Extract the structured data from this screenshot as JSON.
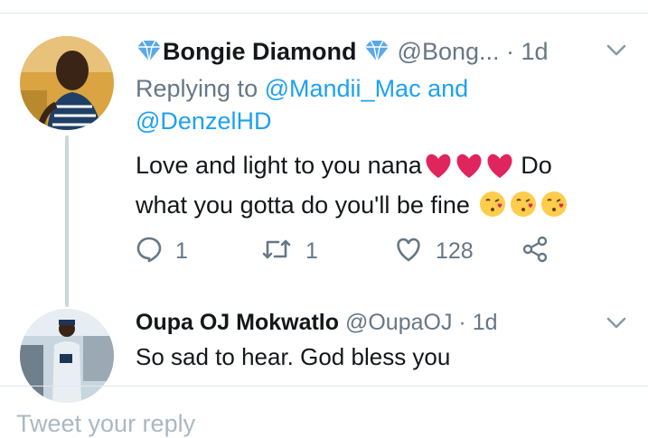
{
  "tweets": [
    {
      "author_name": "Bongie Diamond",
      "handle": "@Bong...",
      "time": "1d",
      "replying_label": "Replying to",
      "mentions": [
        "@Mandii_Mac",
        "@DenzelHD"
      ],
      "connector": "and",
      "text_part1": "Love and light to you nana",
      "text_part2": "Do",
      "text_line2": "what you gotta do you'll be fine",
      "replies_count": "1",
      "retweets_count": "1",
      "likes_count": "128",
      "icons": {
        "reply": "reply-icon",
        "retweet": "retweet-icon",
        "like": "heart-icon",
        "share": "share-icon",
        "menu": "chevron-down-icon",
        "badge": "blue-diamond-emoji"
      }
    },
    {
      "author_name": "Oupa OJ Mokwatlo",
      "handle": "@OupaOJ",
      "time": "1d",
      "text": "So sad to hear. God bless you"
    }
  ],
  "footer": {
    "compose_placeholder": "Tweet your reply"
  },
  "colors": {
    "accent": "#1da1f2",
    "muted": "#657786",
    "heart": "#e0245e",
    "divider": "#e1e8ed"
  }
}
